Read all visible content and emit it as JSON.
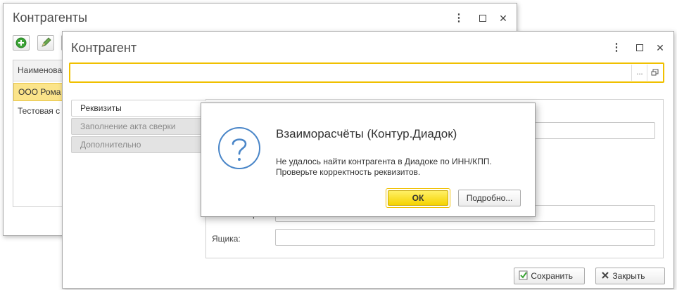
{
  "back_window": {
    "title": "Контрагенты",
    "controls": {
      "menu": "⋮",
      "close": "✕"
    },
    "table": {
      "columns": [
        "Наименова"
      ],
      "rows": [
        "ООО Рома",
        "Тестовая с"
      ]
    }
  },
  "front_window": {
    "title": "Контрагент",
    "controls": {
      "menu": "⋮",
      "close": "✕"
    },
    "name_field": {
      "value": "",
      "select_label": "..."
    },
    "tabs": [
      "Реквизиты",
      "Заполнение акта сверки",
      "Дополнительно"
    ],
    "fields": [
      {
        "label": "р",
        "value": ""
      },
      {
        "label": "Ящика:",
        "value": ""
      }
    ],
    "buttons": {
      "save": "Сохранить",
      "close": "Закрыть"
    }
  },
  "dialog": {
    "title": "Взаиморасчёты (Контур.Диадок)",
    "message_line1": "Не удалось найти контрагента в Диадоке по ИНН/КПП.",
    "message_line2": "Проверьте корректность реквизитов.",
    "ok_label": "ОК",
    "details_label": "Подробно...",
    "icon": "question-icon"
  },
  "colors": {
    "accent_yellow": "#f5d300",
    "focus_border": "#f0c000",
    "selected_row": "#fbe48a",
    "icon_blue": "#4a86c8",
    "green_add": "#3aa335"
  }
}
